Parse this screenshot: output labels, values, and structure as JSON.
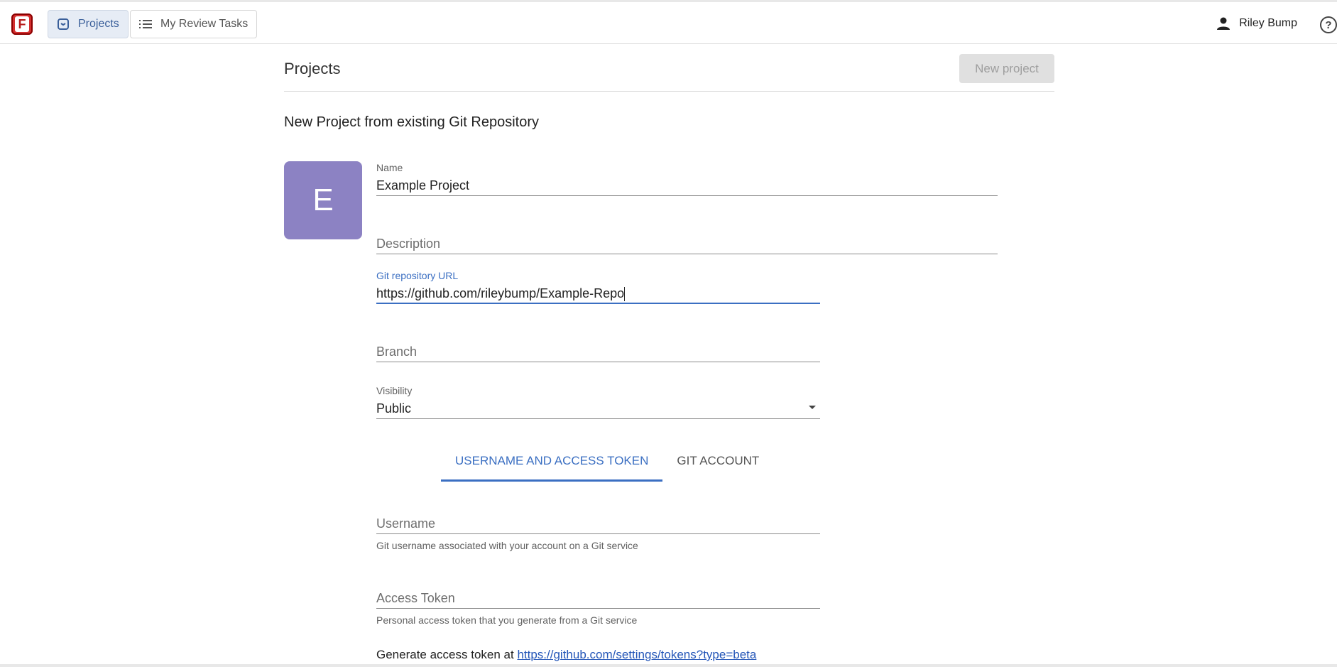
{
  "header": {
    "logo_letter": "F",
    "nav": [
      {
        "label": "Projects",
        "active": true
      },
      {
        "label": "My Review Tasks",
        "active": false
      }
    ],
    "user_name": "Riley Bump",
    "help_symbol": "?"
  },
  "page": {
    "title": "Projects",
    "new_project_label": "New project",
    "section_title": "New Project from existing Git Repository"
  },
  "form": {
    "avatar_letter": "E",
    "name": {
      "label": "Name",
      "value": "Example Project"
    },
    "description": {
      "placeholder": "Description"
    },
    "git_url": {
      "label": "Git repository URL",
      "value": "https://github.com/rileybump/Example-Repo"
    },
    "branch": {
      "placeholder": "Branch"
    },
    "visibility": {
      "label": "Visibility",
      "value": "Public"
    },
    "tabs": [
      {
        "label": "USERNAME AND ACCESS TOKEN",
        "active": true
      },
      {
        "label": "GIT ACCOUNT",
        "active": false
      }
    ],
    "username": {
      "placeholder": "Username",
      "helper": "Git username associated with your account on a Git service"
    },
    "access_token": {
      "placeholder": "Access Token",
      "helper": "Personal access token that you generate from a Git service"
    },
    "generate": {
      "prefix": "Generate access token at ",
      "link": "https://github.com/settings/tokens?type=beta"
    }
  },
  "colors": {
    "accent": "#3b6fc2",
    "avatar": "#8c82c3",
    "logo": "#d32f2f"
  },
  "icons": {
    "projects": "folder-icon",
    "tasks": "list-icon",
    "user": "person-icon",
    "help": "help-circle-icon"
  }
}
